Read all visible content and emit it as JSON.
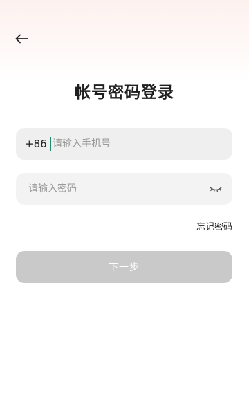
{
  "header": {
    "back_icon": "arrow-left-icon"
  },
  "title": "帐号密码登录",
  "phone": {
    "country_code": "+86",
    "placeholder": "请输入手机号",
    "value": ""
  },
  "password": {
    "placeholder": "请输入密码",
    "value": "",
    "toggle_icon": "eye-closed-icon"
  },
  "forgot_password": "忘记密码",
  "next_button": "下一步",
  "colors": {
    "cursor": "#1e8f6e",
    "button_disabled": "#c9c9c9",
    "field_bg": "#efefef"
  }
}
